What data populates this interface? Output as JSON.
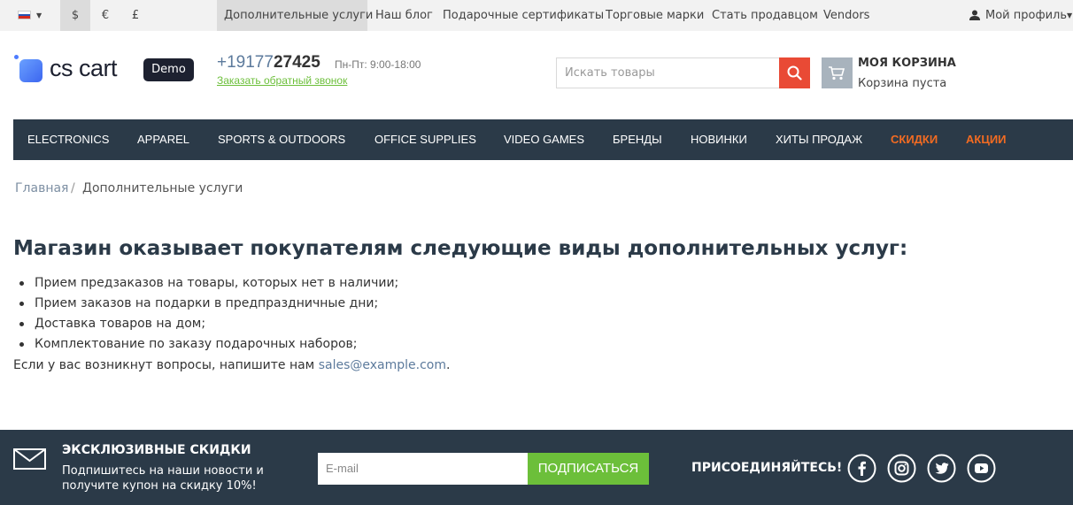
{
  "topbar": {
    "language_flag": "flag-ru-icon",
    "currencies": [
      "$",
      "€",
      "£"
    ],
    "links": [
      "Дополнительные услуги",
      "Наш блог",
      "Подарочные сертификаты",
      "Торговые марки",
      "Стать продавцом",
      "Vendors"
    ],
    "profile_label": "Мой профиль"
  },
  "header": {
    "logo_text": "cs cart",
    "badge": "Demo",
    "phone_prefix": "+19177",
    "phone_main": "27425",
    "hours": "Пн-Пт: 9:00-18:00",
    "callback_label": "Заказать обратный звонок",
    "search_placeholder": "Искать товары",
    "cart_title": "МОЯ КОРЗИНА",
    "cart_status": "Корзина пуста"
  },
  "nav": {
    "items": [
      "ELECTRONICS",
      "APPAREL",
      "SPORTS & OUTDOORS",
      "OFFICE SUPPLIES",
      "VIDEO GAMES",
      "БРЕНДЫ",
      "НОВИНКИ",
      "ХИТЫ ПРОДАЖ",
      "СКИДКИ",
      "АКЦИИ"
    ]
  },
  "breadcrumb": {
    "home": "Главная",
    "separator": "/",
    "current": "Дополнительные услуги"
  },
  "content": {
    "heading": "Магазин оказывает покупателям следующие виды дополнительных услуг:",
    "items": [
      "Прием предзаказов на товары, которых нет в наличии;",
      "Прием заказов на подарки в предпраздничные дни;",
      "Доставка товаров на дом;",
      "Комплектование по заказу подарочных наборов;"
    ],
    "contact_text": "Если у вас возникнут вопросы, напишите нам ",
    "contact_email": "sales@example.com",
    "contact_end": "."
  },
  "footer": {
    "title": "ЭКСКЛЮЗИВНЫЕ СКИДКИ",
    "text": "Подпишитесь на наши новости и получите купон на скидку 10%!",
    "email_placeholder": "E-mail",
    "subscribe_label": "ПОДПИСАТЬСЯ",
    "join_label": "ПРИСОЕДИНЯЙТЕСЬ!",
    "socials": [
      "facebook-icon",
      "instagram-icon",
      "twitter-icon",
      "youtube-icon"
    ]
  },
  "colors": {
    "nav_bg": "#2b3a48",
    "accent_orange": "#f26b22",
    "search_red": "#e94a35",
    "green": "#6cbf3a",
    "link_blue": "#5c7a9c"
  }
}
